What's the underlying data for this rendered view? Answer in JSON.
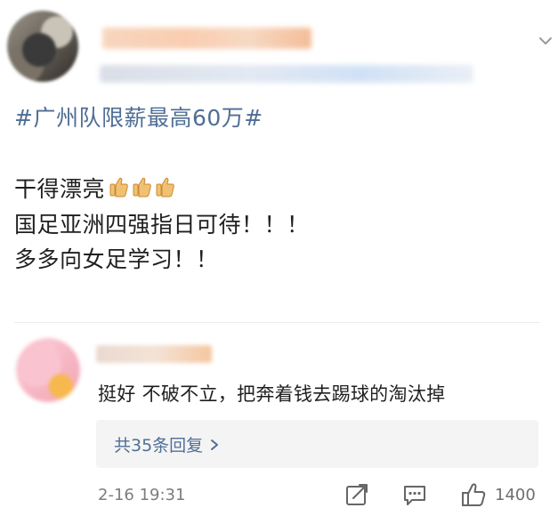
{
  "post": {
    "hashtag": "#广州队限薪最高60万#",
    "lines": {
      "line1": "干得漂亮",
      "line2": "国足亚洲四强指日可待！！！",
      "line3": "多多向女足学习！！"
    },
    "line1_emoji": "thumbs-up-icon x3"
  },
  "comment": {
    "text": "挺好 不破不立，把奔着钱去踢球的淘汰掉",
    "replies_label": "共35条回复",
    "timestamp": "2-16 19:31",
    "like_count": "1400"
  },
  "colors": {
    "link": "#4f6e96",
    "text": "#1f1f1f",
    "muted": "#7d7d7d",
    "reply_bg": "#f4f4f4"
  }
}
